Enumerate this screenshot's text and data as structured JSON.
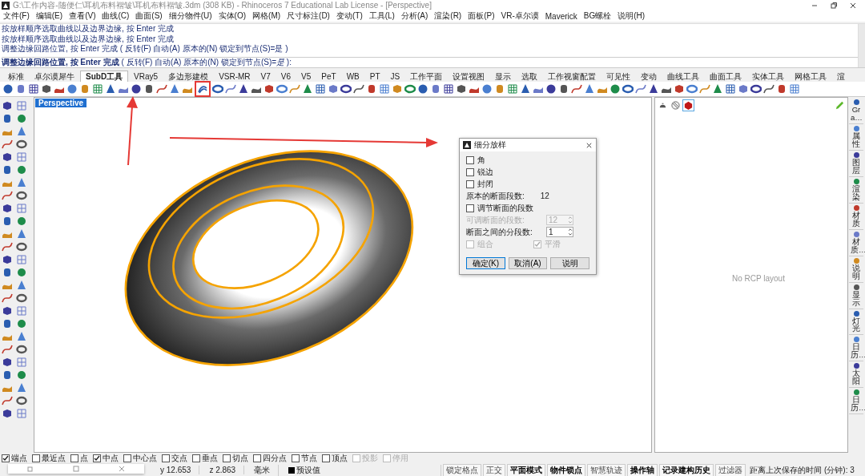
{
  "window": {
    "title": "G:\\工作内容-随便仁\\耳机布料褶皱\\耳机布料褶皱.3dm (308 KB) - Rhinoceros 7 Educational Lab License - [Perspective]"
  },
  "menu": [
    "文件(F)",
    "编辑(E)",
    "查看(V)",
    "曲线(C)",
    "曲面(S)",
    "细分物件(U)",
    "实体(O)",
    "网格(M)",
    "尺寸标注(D)",
    "变动(T)",
    "工具(L)",
    "分析(A)",
    "渲染(R)",
    "面板(P)",
    "VR-卓尔谟",
    "Maverick",
    "BG螺栓",
    "说明(H)"
  ],
  "command_history": [
    "按放样顺序选取曲线以及边界边缘, 按 Enter 完成",
    "按放样顺序选取曲线以及边界边缘, 按 Enter 完成",
    "调整边缘回路位置, 按 Enter 完成 ( 反转(F)  自动(A)  原本的(N)  锁定到节点(S)=是 )"
  ],
  "command_prompt": "**调整边缘回路位置, 按 Enter 完成** ( 反转(F)  自动(A)  原本的(N)  锁定到节点(S)=*是* ):",
  "toolbar_tabs": [
    {
      "label": "标准",
      "selected": false
    },
    {
      "label": "卓尔谟犀牛",
      "selected": false
    },
    {
      "label": "SubD工具",
      "selected": true
    },
    {
      "label": "VRay5",
      "selected": false
    },
    {
      "label": "多边形建模",
      "selected": false
    },
    {
      "label": "VSR-MR",
      "selected": false
    },
    {
      "label": "V7",
      "selected": false
    },
    {
      "label": "V6",
      "selected": false
    },
    {
      "label": "V5",
      "selected": false
    },
    {
      "label": "PeT",
      "selected": false
    },
    {
      "label": "WB",
      "selected": false
    },
    {
      "label": "PT",
      "selected": false
    },
    {
      "label": "JS",
      "selected": false
    },
    {
      "label": "工作平面",
      "selected": false
    },
    {
      "label": "设置视图",
      "selected": false
    },
    {
      "label": "显示",
      "selected": false
    },
    {
      "label": "选取",
      "selected": false
    },
    {
      "label": "工作视窗配置",
      "selected": false
    },
    {
      "label": "可见性",
      "selected": false
    },
    {
      "label": "变动",
      "selected": false
    },
    {
      "label": "曲线工具",
      "selected": false
    },
    {
      "label": "曲面工具",
      "selected": false
    },
    {
      "label": "实体工具",
      "selected": false
    },
    {
      "label": "网格工具",
      "selected": false
    },
    {
      "label": "渲",
      "selected": false
    }
  ],
  "viewport": {
    "label": "Perspective"
  },
  "dialog": {
    "title": "细分放样",
    "options": [
      {
        "label": "角",
        "checked": false
      },
      {
        "label": "锐边",
        "checked": false
      },
      {
        "label": "封闭",
        "checked": false
      }
    ],
    "original_count_label": "原本的断面段数:",
    "original_count": "12",
    "adjust": {
      "label": "调节断面的段数",
      "checked": false
    },
    "adjustable_label": "可调断面的段数:",
    "adjustable_value": "12",
    "adjustable_disabled": true,
    "spans_label": "断面之间的分段数:",
    "spans_value": "1",
    "bottom_options": [
      {
        "label": "组合",
        "checked": false,
        "disabled": true
      },
      {
        "label": "平滑",
        "checked": true,
        "disabled": true
      }
    ],
    "buttons": [
      "确定(K)",
      "取消(A)",
      "说明"
    ]
  },
  "panel": {
    "message": "No RCP layout",
    "side_tabs": [
      "Gra…",
      "属性",
      "图层",
      "渲染",
      "材质",
      "材质…",
      "说明",
      "显示",
      "灯光",
      "日历…",
      "太阳",
      "日历…"
    ]
  },
  "osnap": [
    {
      "label": "端点",
      "checked": true,
      "disabled": false
    },
    {
      "label": "最近点",
      "checked": false,
      "disabled": false
    },
    {
      "label": "点",
      "checked": false,
      "disabled": false
    },
    {
      "label": "中点",
      "checked": true,
      "disabled": false
    },
    {
      "label": "中心点",
      "checked": false,
      "disabled": false
    },
    {
      "label": "交点",
      "checked": false,
      "disabled": false
    },
    {
      "label": "垂点",
      "checked": false,
      "disabled": false
    },
    {
      "label": "切点",
      "checked": false,
      "disabled": false
    },
    {
      "label": "四分点",
      "checked": false,
      "disabled": false
    },
    {
      "label": "节点",
      "checked": false,
      "disabled": false
    },
    {
      "label": "顶点",
      "checked": false,
      "disabled": false
    },
    {
      "label": "投影",
      "checked": false,
      "disabled": true
    },
    {
      "label": "停用",
      "checked": false,
      "disabled": true
    }
  ],
  "status_bar": {
    "coords": [
      "y 12.653",
      "z 2.863"
    ],
    "units": "毫米",
    "layer": "预设值",
    "toggles": [
      {
        "label": "锁定格点",
        "on": false
      },
      {
        "label": "正交",
        "on": false
      },
      {
        "label": "平面模式",
        "on": true
      },
      {
        "label": "物件锁点",
        "on": true
      },
      {
        "label": "智慧轨迹",
        "on": false
      },
      {
        "label": "操作轴",
        "on": true
      },
      {
        "label": "记录建构历史",
        "on": true
      },
      {
        "label": "过滤器",
        "on": false
      }
    ],
    "save_info": "距离上次保存的时间 (分钟): 3"
  }
}
